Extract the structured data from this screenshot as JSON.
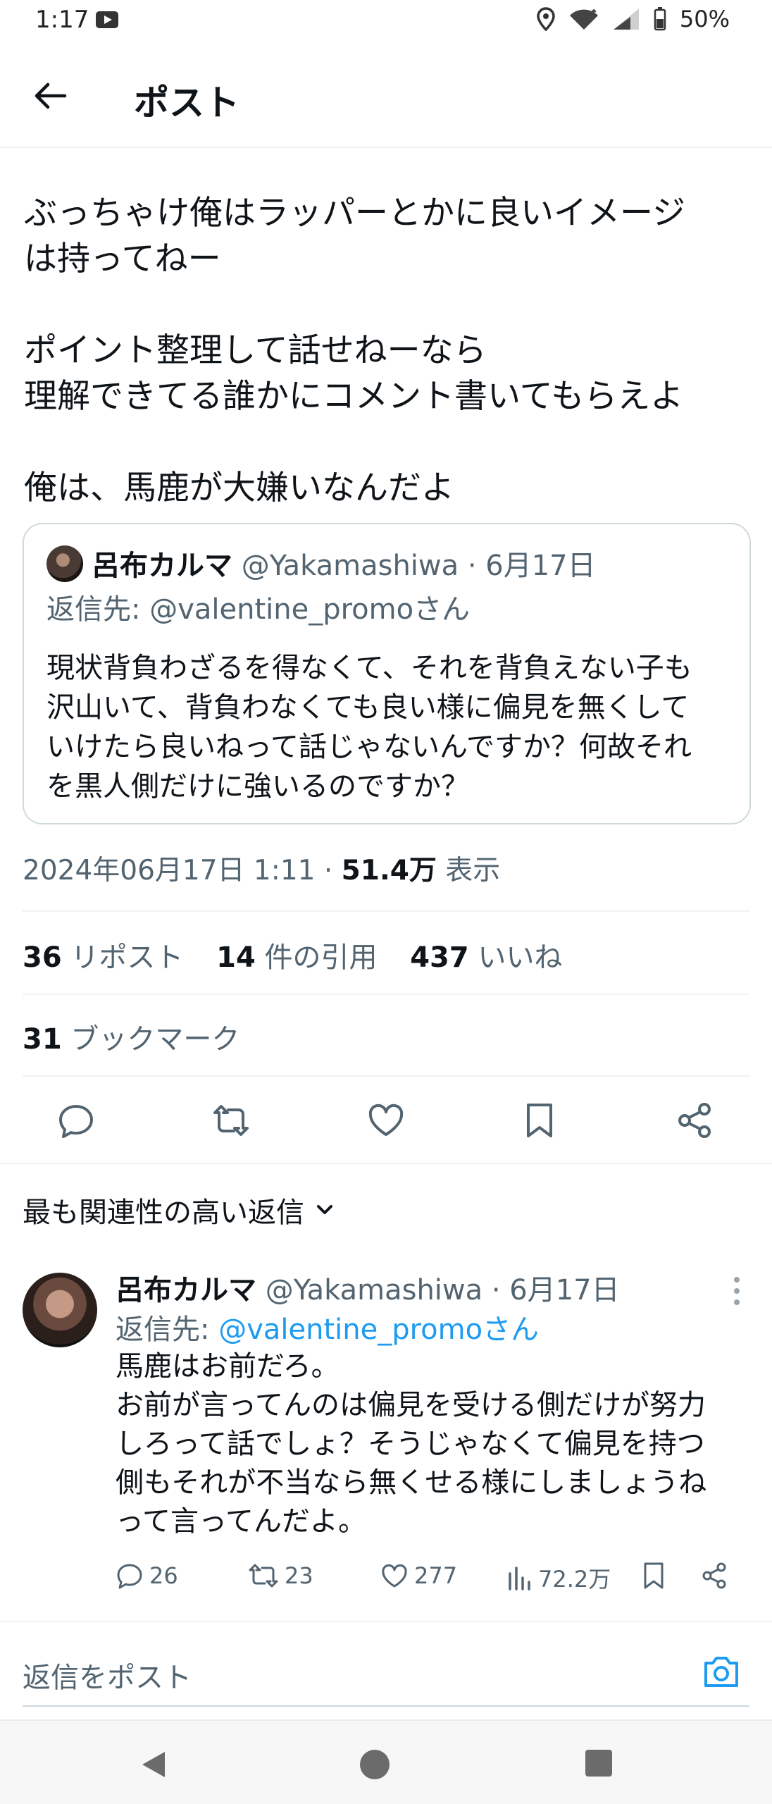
{
  "status_bar": {
    "time": "1:17",
    "battery": "50%"
  },
  "header": {
    "title": "ポスト"
  },
  "tweet": {
    "text": "ぶっちゃけ俺はラッパーとかに良いイメージ\nは持ってねー\n\nポイント整理して話せねーなら\n理解できてる誰かにコメント書いてもらえよ\n\n俺は、馬鹿が大嫌いなんだよ",
    "timestamp": "2024年06月17日 1:11 · ",
    "views_count": "51.4万",
    "views_label": " 表示"
  },
  "quoted": {
    "name": "呂布カルマ",
    "meta": " @Yakamashiwa · 6月17日",
    "reply_to": "返信先: @valentine_promoさん",
    "text": "現状背負わざるを得なくて、それを背負えない子も\n沢山いて、背負わなくても良い様に偏見を無くして\nいけたら良いねって話じゃないんですか？何故それ\nを黒人側だけに強いるのですか？"
  },
  "stats": {
    "reposts_count": "36",
    "reposts_label": " リポスト",
    "quotes_count": "14",
    "quotes_label": " 件の引用",
    "likes_count": "437",
    "likes_label": " いいね",
    "bookmarks_count": "31",
    "bookmarks_label": " ブックマーク"
  },
  "sort": {
    "label": "最も関連性の高い返信"
  },
  "reply": {
    "name": "呂布カルマ",
    "meta": " @Yakamashiwa · 6月17日",
    "reply_to_prefix": "返信先: ",
    "reply_to_handle": "@valentine_promoさん",
    "text": "馬鹿はお前だろ。\nお前が言ってんのは偏見を受ける側だけが努力\nしろって話でしょ？そうじゃなくて偏見を持つ\n側もそれが不当なら無くせる様にしましょうね\nって言ってんだよ。",
    "replies": "26",
    "reposts": "23",
    "likes": "277",
    "views": "72.2万"
  },
  "compose": {
    "placeholder": "返信をポスト"
  },
  "colors": {
    "accent": "#1d9bf0",
    "text": "#0f1419",
    "secondary": "#536471"
  }
}
